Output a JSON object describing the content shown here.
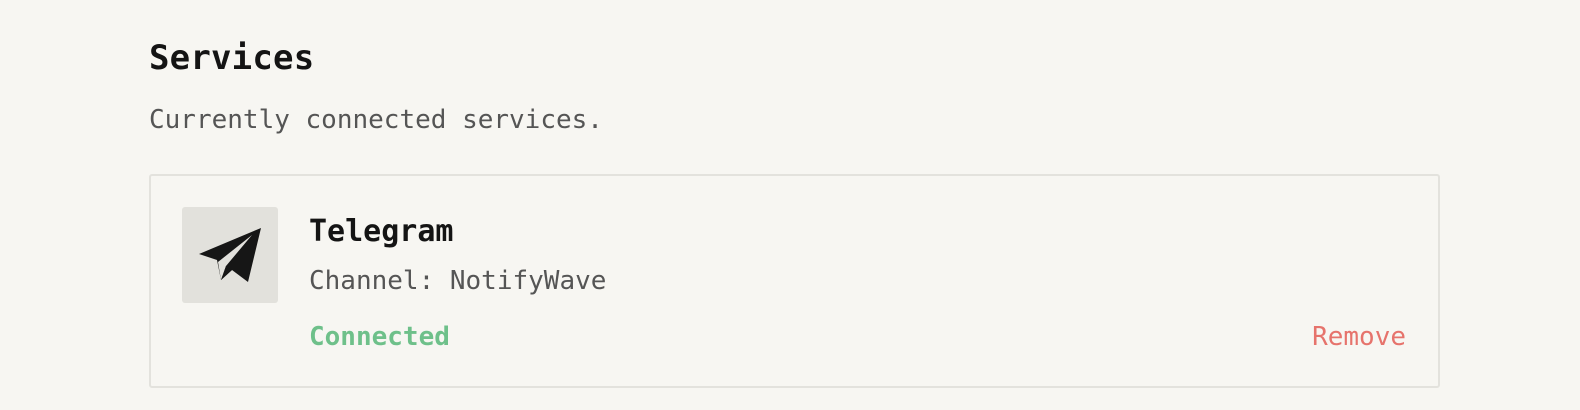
{
  "section": {
    "title": "Services",
    "subtitle": "Currently connected services."
  },
  "services": [
    {
      "name": "Telegram",
      "icon": "telegram-icon",
      "detail": "Channel: NotifyWave",
      "status": "Connected",
      "remove_label": "Remove"
    }
  ],
  "colors": {
    "background": "#f7f6f2",
    "status_connected": "#6ec08a",
    "remove": "#e6736c",
    "icon_tile": "#e2e1dc"
  }
}
